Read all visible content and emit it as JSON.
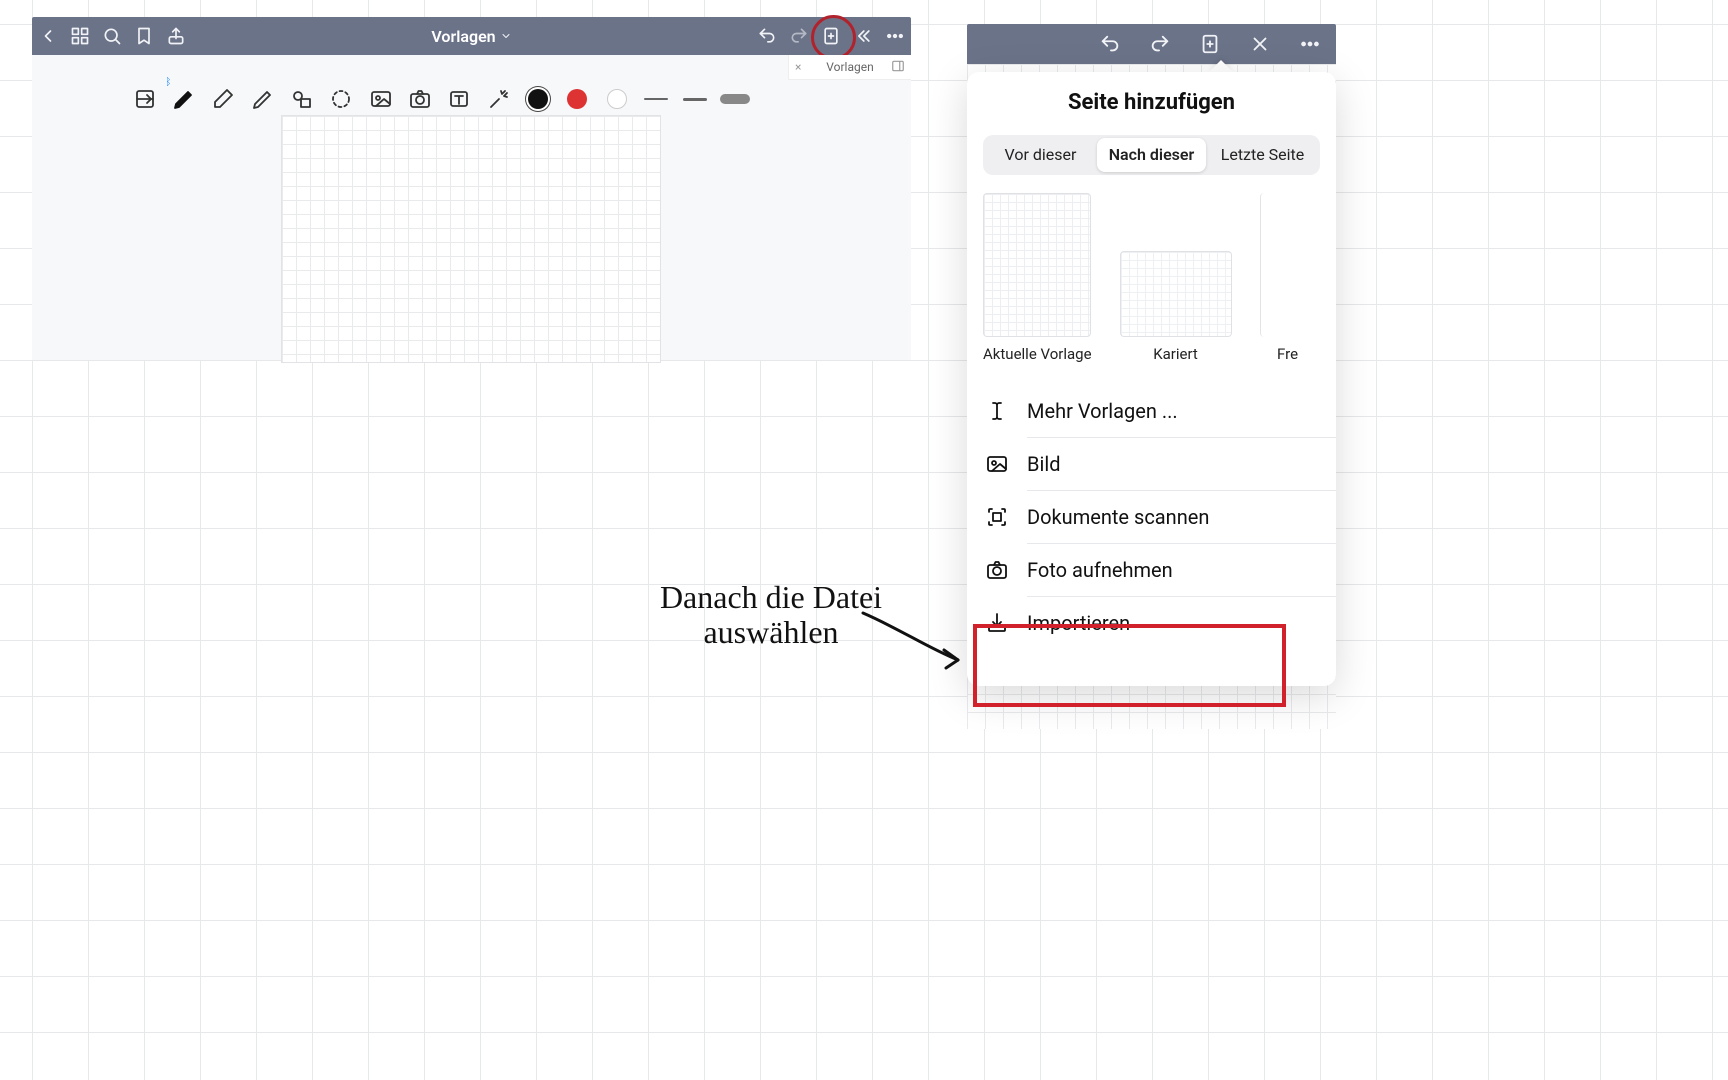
{
  "app1": {
    "title": "Vorlagen",
    "tab_label": "Vorlagen"
  },
  "popover": {
    "title": "Seite hinzufügen",
    "segments": {
      "before": "Vor dieser",
      "after": "Nach dieser",
      "last": "Letzte Seite"
    },
    "templates": {
      "current": "Aktuelle Vorlage",
      "squared": "Kariert",
      "free": "Fre"
    },
    "menu": {
      "more": "Mehr Vorlagen ...",
      "image": "Bild",
      "scan": "Dokumente scannen",
      "photo": "Foto aufnehmen",
      "import": "Importieren"
    }
  },
  "annotation": {
    "line1": "Danach die Datei",
    "line2": "auswählen"
  }
}
